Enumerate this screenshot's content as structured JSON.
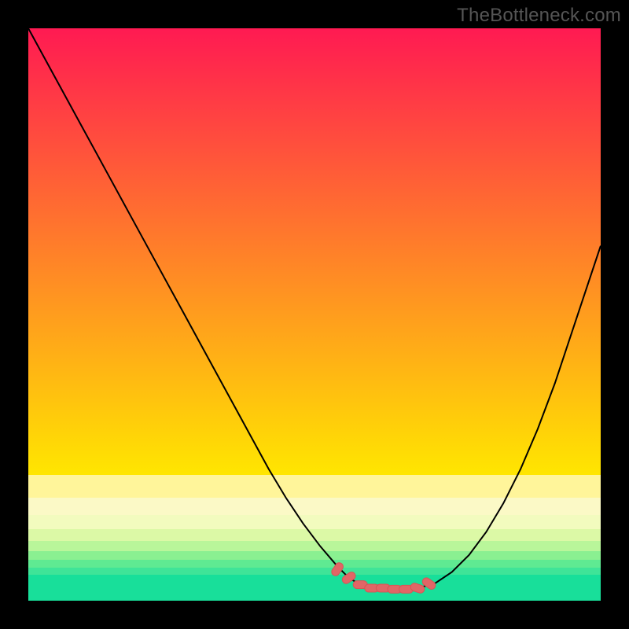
{
  "watermark": "TheBottleneck.com",
  "colors": {
    "black": "#000000",
    "marker": "#e16666"
  },
  "gradient_bands": [
    {
      "top_pct": 0.0,
      "height_pct": 78.0,
      "type": "linear",
      "from": "#ff1a52",
      "to": "#ffe600"
    },
    {
      "top_pct": 78.0,
      "height_pct": 4.0,
      "type": "solid",
      "color": "#fff59a"
    },
    {
      "top_pct": 82.0,
      "height_pct": 3.0,
      "type": "solid",
      "color": "#fbf9c6"
    },
    {
      "top_pct": 85.0,
      "height_pct": 2.5,
      "type": "solid",
      "color": "#f2fbbe"
    },
    {
      "top_pct": 87.5,
      "height_pct": 2.0,
      "type": "solid",
      "color": "#dcf9a6"
    },
    {
      "top_pct": 89.5,
      "height_pct": 1.8,
      "type": "solid",
      "color": "#b9f69a"
    },
    {
      "top_pct": 91.3,
      "height_pct": 1.5,
      "type": "solid",
      "color": "#8af091"
    },
    {
      "top_pct": 92.8,
      "height_pct": 1.4,
      "type": "solid",
      "color": "#5fea92"
    },
    {
      "top_pct": 94.2,
      "height_pct": 1.3,
      "type": "solid",
      "color": "#3fe498"
    },
    {
      "top_pct": 95.5,
      "height_pct": 4.5,
      "type": "solid",
      "color": "#18df9a"
    }
  ],
  "chart_data": {
    "type": "line",
    "title": "",
    "xlabel": "",
    "ylabel": "",
    "xrange": [
      0,
      100
    ],
    "yrange": [
      0,
      100
    ],
    "series": [
      {
        "name": "bottleneck-curve",
        "x": [
          0,
          3,
          6,
          9,
          12,
          15,
          18,
          21,
          24,
          27,
          30,
          33,
          36,
          39,
          42,
          45,
          48,
          51,
          54,
          56,
          58,
          60,
          62,
          65,
          68,
          71,
          74,
          77,
          80,
          83,
          86,
          89,
          92,
          95,
          98,
          100
        ],
        "y": [
          100,
          94.5,
          89,
          83.5,
          78,
          72.5,
          67,
          61.5,
          56,
          50.5,
          45,
          39.5,
          34,
          28.5,
          23,
          18,
          13.5,
          9.5,
          6.0,
          4.0,
          2.8,
          2.2,
          2.0,
          2.0,
          2.2,
          3.0,
          5.0,
          8.0,
          12.0,
          17.0,
          23.0,
          30.0,
          38.0,
          47.0,
          56.0,
          62.0
        ]
      }
    ],
    "markers": {
      "name": "optimal-zone",
      "x": [
        54,
        56,
        58,
        60,
        62,
        64,
        66,
        68,
        70
      ],
      "y": [
        5.5,
        4.0,
        2.8,
        2.2,
        2.2,
        2.0,
        2.0,
        2.2,
        3.0
      ]
    }
  }
}
